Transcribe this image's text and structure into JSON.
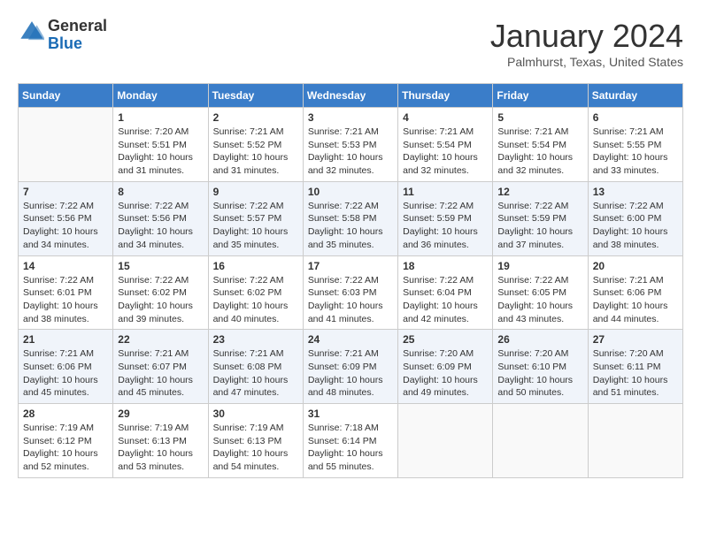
{
  "header": {
    "logo_line1": "General",
    "logo_line2": "Blue",
    "month_title": "January 2024",
    "location": "Palmhurst, Texas, United States"
  },
  "days_of_week": [
    "Sunday",
    "Monday",
    "Tuesday",
    "Wednesday",
    "Thursday",
    "Friday",
    "Saturday"
  ],
  "weeks": [
    [
      {
        "day": "",
        "info": ""
      },
      {
        "day": "1",
        "info": "Sunrise: 7:20 AM\nSunset: 5:51 PM\nDaylight: 10 hours\nand 31 minutes."
      },
      {
        "day": "2",
        "info": "Sunrise: 7:21 AM\nSunset: 5:52 PM\nDaylight: 10 hours\nand 31 minutes."
      },
      {
        "day": "3",
        "info": "Sunrise: 7:21 AM\nSunset: 5:53 PM\nDaylight: 10 hours\nand 32 minutes."
      },
      {
        "day": "4",
        "info": "Sunrise: 7:21 AM\nSunset: 5:54 PM\nDaylight: 10 hours\nand 32 minutes."
      },
      {
        "day": "5",
        "info": "Sunrise: 7:21 AM\nSunset: 5:54 PM\nDaylight: 10 hours\nand 32 minutes."
      },
      {
        "day": "6",
        "info": "Sunrise: 7:21 AM\nSunset: 5:55 PM\nDaylight: 10 hours\nand 33 minutes."
      }
    ],
    [
      {
        "day": "7",
        "info": "Sunrise: 7:22 AM\nSunset: 5:56 PM\nDaylight: 10 hours\nand 34 minutes."
      },
      {
        "day": "8",
        "info": "Sunrise: 7:22 AM\nSunset: 5:56 PM\nDaylight: 10 hours\nand 34 minutes."
      },
      {
        "day": "9",
        "info": "Sunrise: 7:22 AM\nSunset: 5:57 PM\nDaylight: 10 hours\nand 35 minutes."
      },
      {
        "day": "10",
        "info": "Sunrise: 7:22 AM\nSunset: 5:58 PM\nDaylight: 10 hours\nand 35 minutes."
      },
      {
        "day": "11",
        "info": "Sunrise: 7:22 AM\nSunset: 5:59 PM\nDaylight: 10 hours\nand 36 minutes."
      },
      {
        "day": "12",
        "info": "Sunrise: 7:22 AM\nSunset: 5:59 PM\nDaylight: 10 hours\nand 37 minutes."
      },
      {
        "day": "13",
        "info": "Sunrise: 7:22 AM\nSunset: 6:00 PM\nDaylight: 10 hours\nand 38 minutes."
      }
    ],
    [
      {
        "day": "14",
        "info": "Sunrise: 7:22 AM\nSunset: 6:01 PM\nDaylight: 10 hours\nand 38 minutes."
      },
      {
        "day": "15",
        "info": "Sunrise: 7:22 AM\nSunset: 6:02 PM\nDaylight: 10 hours\nand 39 minutes."
      },
      {
        "day": "16",
        "info": "Sunrise: 7:22 AM\nSunset: 6:02 PM\nDaylight: 10 hours\nand 40 minutes."
      },
      {
        "day": "17",
        "info": "Sunrise: 7:22 AM\nSunset: 6:03 PM\nDaylight: 10 hours\nand 41 minutes."
      },
      {
        "day": "18",
        "info": "Sunrise: 7:22 AM\nSunset: 6:04 PM\nDaylight: 10 hours\nand 42 minutes."
      },
      {
        "day": "19",
        "info": "Sunrise: 7:22 AM\nSunset: 6:05 PM\nDaylight: 10 hours\nand 43 minutes."
      },
      {
        "day": "20",
        "info": "Sunrise: 7:21 AM\nSunset: 6:06 PM\nDaylight: 10 hours\nand 44 minutes."
      }
    ],
    [
      {
        "day": "21",
        "info": "Sunrise: 7:21 AM\nSunset: 6:06 PM\nDaylight: 10 hours\nand 45 minutes."
      },
      {
        "day": "22",
        "info": "Sunrise: 7:21 AM\nSunset: 6:07 PM\nDaylight: 10 hours\nand 45 minutes."
      },
      {
        "day": "23",
        "info": "Sunrise: 7:21 AM\nSunset: 6:08 PM\nDaylight: 10 hours\nand 47 minutes."
      },
      {
        "day": "24",
        "info": "Sunrise: 7:21 AM\nSunset: 6:09 PM\nDaylight: 10 hours\nand 48 minutes."
      },
      {
        "day": "25",
        "info": "Sunrise: 7:20 AM\nSunset: 6:09 PM\nDaylight: 10 hours\nand 49 minutes."
      },
      {
        "day": "26",
        "info": "Sunrise: 7:20 AM\nSunset: 6:10 PM\nDaylight: 10 hours\nand 50 minutes."
      },
      {
        "day": "27",
        "info": "Sunrise: 7:20 AM\nSunset: 6:11 PM\nDaylight: 10 hours\nand 51 minutes."
      }
    ],
    [
      {
        "day": "28",
        "info": "Sunrise: 7:19 AM\nSunset: 6:12 PM\nDaylight: 10 hours\nand 52 minutes."
      },
      {
        "day": "29",
        "info": "Sunrise: 7:19 AM\nSunset: 6:13 PM\nDaylight: 10 hours\nand 53 minutes."
      },
      {
        "day": "30",
        "info": "Sunrise: 7:19 AM\nSunset: 6:13 PM\nDaylight: 10 hours\nand 54 minutes."
      },
      {
        "day": "31",
        "info": "Sunrise: 7:18 AM\nSunset: 6:14 PM\nDaylight: 10 hours\nand 55 minutes."
      },
      {
        "day": "",
        "info": ""
      },
      {
        "day": "",
        "info": ""
      },
      {
        "day": "",
        "info": ""
      }
    ]
  ]
}
